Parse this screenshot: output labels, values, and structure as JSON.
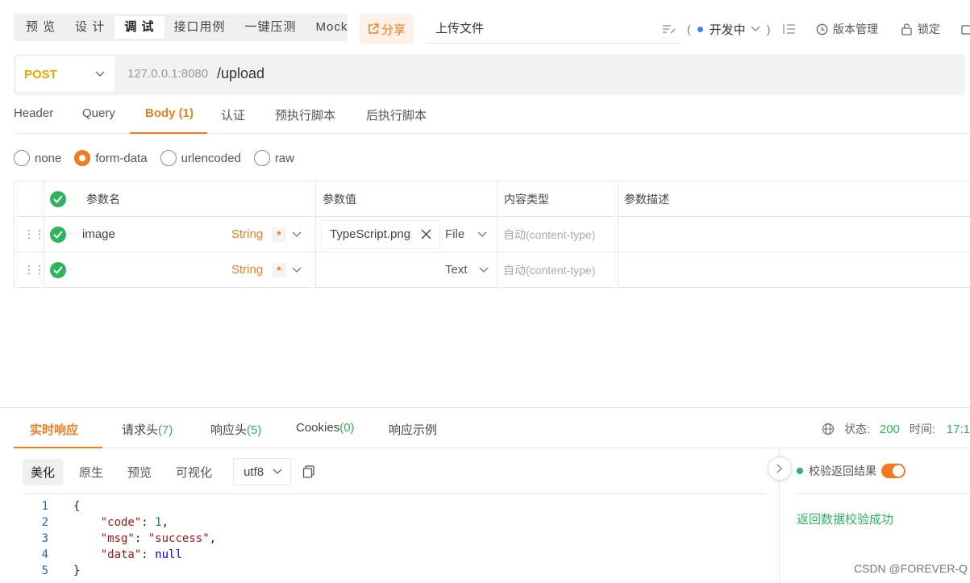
{
  "toolbar": {
    "mode_tabs": [
      "预 览",
      "设 计",
      "调 试",
      "接口用例",
      "一键压测",
      "Mock"
    ],
    "active_mode_index": 2,
    "share_label": "分享",
    "api_name": "上传文件",
    "env_label": "开发中",
    "version_label": "版本管理",
    "lock_label": "锁定"
  },
  "request": {
    "method": "POST",
    "host": "127.0.0.1:8080",
    "path": "/upload",
    "tabs": [
      {
        "label": "Header"
      },
      {
        "label": "Query"
      },
      {
        "label": "Body (1)"
      },
      {
        "label": "认证"
      },
      {
        "label": "预执行脚本"
      },
      {
        "label": "后执行脚本"
      }
    ],
    "active_tab_index": 2,
    "body_modes": [
      "none",
      "form-data",
      "urlencoded",
      "raw"
    ],
    "selected_body_mode": "form-data"
  },
  "params": {
    "headers": {
      "name": "参数名",
      "value": "参数值",
      "content_type": "内容类型",
      "description": "参数描述"
    },
    "rows": [
      {
        "name": "image",
        "type": "String",
        "required": "*",
        "value": "TypeScript.png",
        "value_kind": "File",
        "content_type": "自动(content-type)",
        "description": ""
      },
      {
        "name": "",
        "type": "String",
        "required": "*",
        "value": "",
        "value_kind": "Text",
        "content_type": "自动(content-type)",
        "description": ""
      }
    ]
  },
  "response": {
    "tabs": [
      {
        "label": "实时响应"
      },
      {
        "label": "请求头(7)"
      },
      {
        "label": "响应头(5)"
      },
      {
        "label": "Cookies(0)"
      },
      {
        "label": "响应示例"
      }
    ],
    "active_tab_index": 0,
    "status_label": "状态:",
    "status_code": "200",
    "time_label": "时间:",
    "time_value": "17:1",
    "format_tabs": [
      "美化",
      "原生",
      "预览",
      "可视化"
    ],
    "active_format_index": 0,
    "encoding": "utf8",
    "line_numbers": [
      "1",
      "2",
      "3",
      "4",
      "5"
    ],
    "json_body": {
      "code": "1",
      "msg": "success",
      "data": "null"
    },
    "validate_label": "校验返回结果",
    "validate_result": "返回数据校验成功"
  },
  "watermark": "CSDN @FOREVER-Q",
  "colors": {
    "accent": "#f07c1e",
    "success": "#2db55d",
    "method": "#f0a400"
  }
}
